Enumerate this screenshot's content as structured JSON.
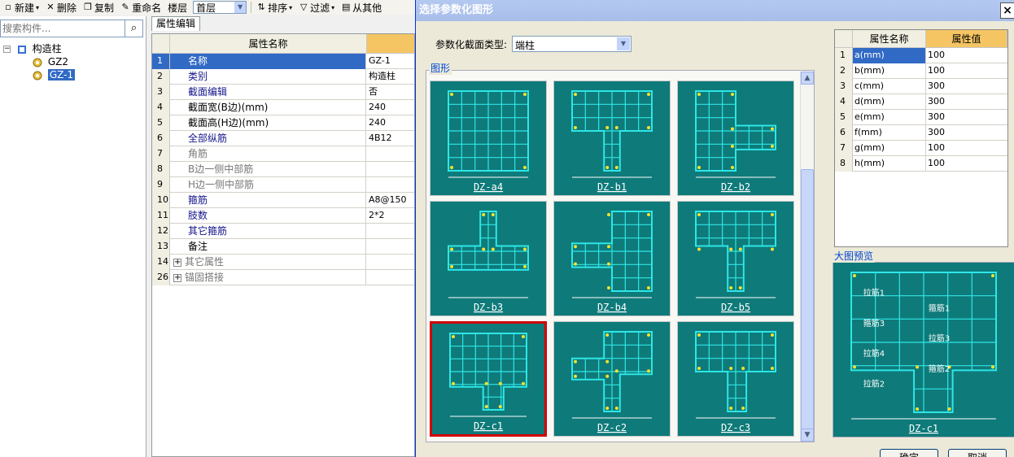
{
  "toolbar": {
    "new": "新建",
    "delete": "删除",
    "copy": "复制",
    "rename": "重命名",
    "floor_label": "楼层",
    "floor_value": "首层",
    "sort": "排序",
    "filter": "过滤",
    "from_other": "从其他"
  },
  "tree": {
    "search_placeholder": "搜索构件...",
    "root": "构造柱",
    "items": [
      "GZ2",
      "GZ-1"
    ]
  },
  "props": {
    "tab": "属性编辑",
    "header_name": "属性名称",
    "rows": [
      {
        "num": "1",
        "name": "名称",
        "value": "GZ-1"
      },
      {
        "num": "2",
        "name": "类别",
        "value": "构造柱"
      },
      {
        "num": "3",
        "name": "截面编辑",
        "value": "否"
      },
      {
        "num": "4",
        "name": "截面宽(B边)(mm)",
        "value": "240"
      },
      {
        "num": "5",
        "name": "截面高(H边)(mm)",
        "value": "240"
      },
      {
        "num": "6",
        "name": "全部纵筋",
        "value": "4B12"
      },
      {
        "num": "7",
        "name": "角筋",
        "value": ""
      },
      {
        "num": "8",
        "name": "B边一侧中部筋",
        "value": ""
      },
      {
        "num": "9",
        "name": "H边一侧中部筋",
        "value": ""
      },
      {
        "num": "10",
        "name": "箍筋",
        "value": "A8@150"
      },
      {
        "num": "11",
        "name": "肢数",
        "value": "2*2"
      },
      {
        "num": "12",
        "name": "其它箍筋",
        "value": ""
      },
      {
        "num": "13",
        "name": "备注",
        "value": ""
      },
      {
        "num": "14",
        "name": "其它属性",
        "value": ""
      },
      {
        "num": "26",
        "name": "锚固搭接",
        "value": ""
      }
    ]
  },
  "dialog": {
    "title": "选择参数化图形",
    "close": "×",
    "type_label": "参数化截面类型:",
    "type_value": "端柱",
    "group_label": "图形",
    "shapes": [
      "DZ-a4",
      "DZ-b1",
      "DZ-b2",
      "DZ-b3",
      "DZ-b4",
      "DZ-b5",
      "DZ-c1",
      "DZ-c2",
      "DZ-c3"
    ],
    "table_header_name": "属性名称",
    "table_header_value": "属性值",
    "params": [
      {
        "num": "1",
        "name": "a(mm)",
        "value": "100"
      },
      {
        "num": "2",
        "name": "b(mm)",
        "value": "100"
      },
      {
        "num": "3",
        "name": "c(mm)",
        "value": "300"
      },
      {
        "num": "4",
        "name": "d(mm)",
        "value": "300"
      },
      {
        "num": "5",
        "name": "e(mm)",
        "value": "300"
      },
      {
        "num": "6",
        "name": "f(mm)",
        "value": "300"
      },
      {
        "num": "7",
        "name": "g(mm)",
        "value": "100"
      },
      {
        "num": "8",
        "name": "h(mm)",
        "value": "100"
      }
    ],
    "preview_label": "大图预览",
    "preview_shape": "DZ-c1",
    "preview_annotations": [
      "拉筋1",
      "箍筋1",
      "箍筋3",
      "拉筋3",
      "拉筋4",
      "箍筋2",
      "拉筋2"
    ],
    "ok": "确定",
    "cancel": "取消"
  },
  "colors": {
    "section_fill": "#0f7a7a",
    "rebar": "#2ee6e6",
    "selection": "#316ac5",
    "selected_border": "#d40000"
  }
}
